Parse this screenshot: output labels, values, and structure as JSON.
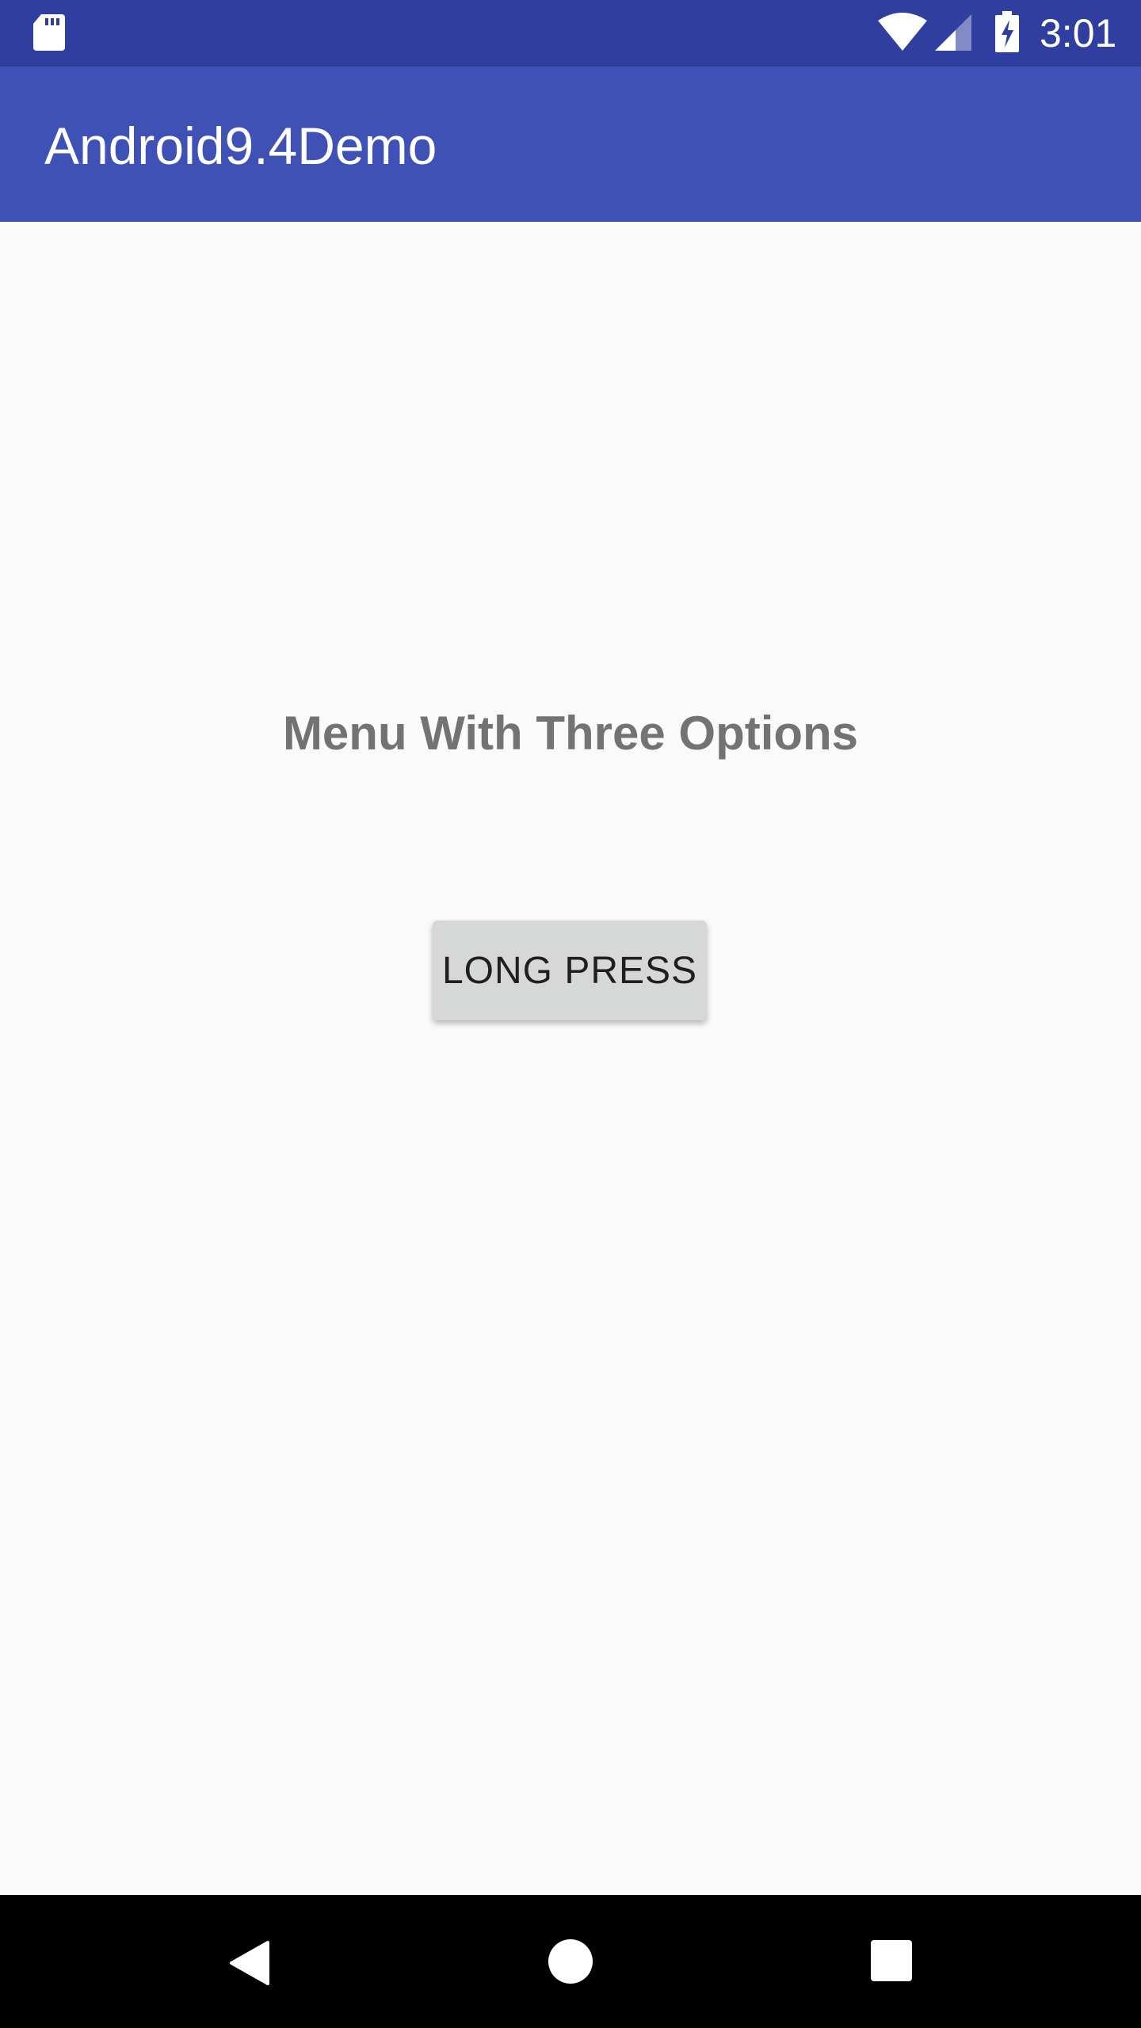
{
  "status_bar": {
    "time": "3:01",
    "icons": [
      "sd-card-icon",
      "wifi-icon",
      "cell-signal-icon",
      "battery-charging-icon"
    ],
    "background_color": "#303f9f"
  },
  "app_bar": {
    "title": "Android9.4Demo",
    "background_color": "#3f51b5"
  },
  "main": {
    "heading": "Menu With Three Options",
    "button_label": "LONG PRESS"
  },
  "nav_bar": {
    "buttons": [
      "back-icon",
      "home-icon",
      "recents-icon"
    ]
  }
}
